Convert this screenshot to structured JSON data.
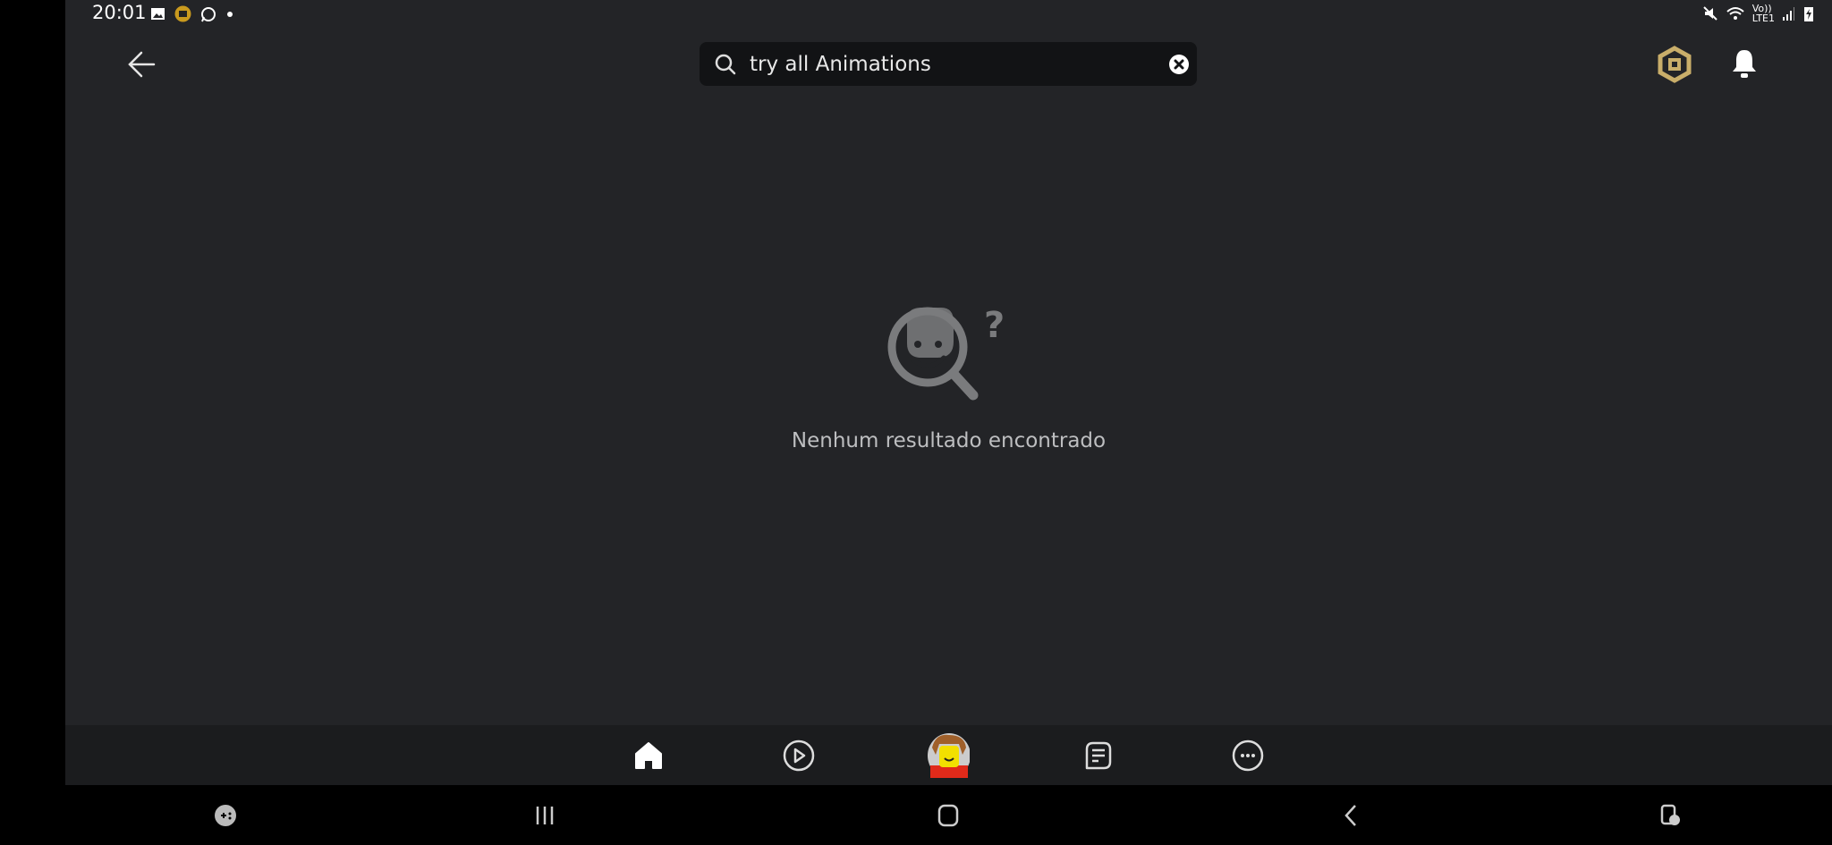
{
  "status_bar": {
    "time": "20:01",
    "network_label_top": "Vo))",
    "network_label_bottom": "LTE1",
    "icons": [
      "gallery-icon",
      "app-notification-icon",
      "whatsapp-icon",
      "dot-icon",
      "mute-icon",
      "wifi-icon",
      "signal-icon",
      "battery-charging-icon"
    ]
  },
  "header": {
    "search_value": "try all Animations",
    "search_icon": "search-icon",
    "clear_icon": "clear-icon",
    "robux_icon": "robux-icon",
    "bell_icon": "bell-icon"
  },
  "empty_state": {
    "message": "Nenhum resultado encontrado",
    "question_mark": "?"
  },
  "tabs": [
    {
      "name": "home",
      "active": true
    },
    {
      "name": "play"
    },
    {
      "name": "avatar"
    },
    {
      "name": "chat"
    },
    {
      "name": "more"
    }
  ],
  "colors": {
    "background": "#232427",
    "search_bg": "#121315",
    "tabbar": "#1b1c1e",
    "robux_gold": "#c9ae6a",
    "illustration": "#7a7b7d"
  }
}
